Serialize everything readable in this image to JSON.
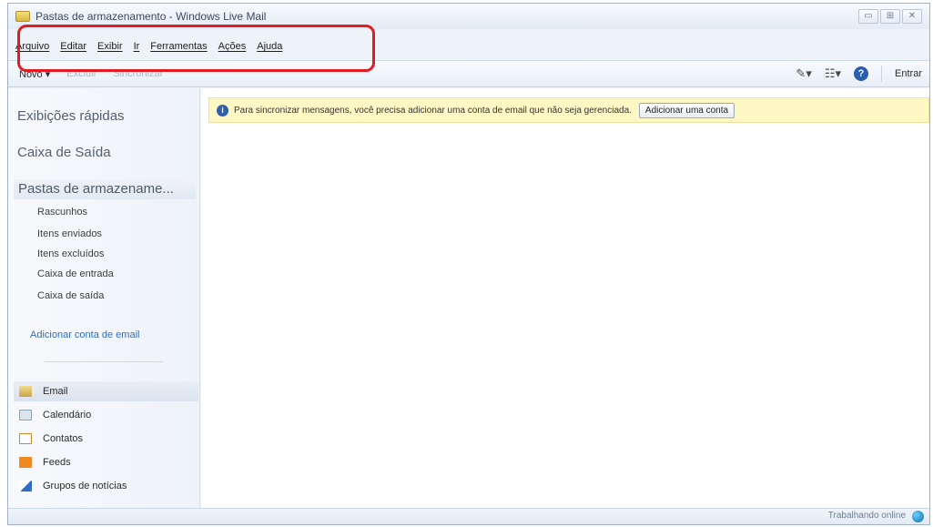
{
  "window": {
    "title": "Pastas de armazenamento - Windows Live Mail",
    "controls": [
      "▭",
      "⊞",
      "✕"
    ]
  },
  "menu": [
    "Arquivo",
    "Editar",
    "Exibir",
    "Ir",
    "Ferramentas",
    "Ações",
    "Ajuda"
  ],
  "toolbar": {
    "new_label": "Novo ▾",
    "faded1": "Excluir",
    "faded2": "Sincronizar",
    "pen_icon": "✎▾",
    "view_icon": "☷▾",
    "help_icon": "?",
    "login_label": "Entrar"
  },
  "sidebar": {
    "quick_views": "Exibições rápidas",
    "outbox_header": "Caixa de Saída",
    "storage_section": "Pastas de armazename...",
    "folders": [
      "Rascunhos",
      "Itens enviados",
      "Itens excluídos",
      "Caixa de entrada",
      "Caixa de saída"
    ],
    "add_account_link": "Adicionar conta de email",
    "nav": [
      "Email",
      "Calendário",
      "Contatos",
      "Feeds",
      "Grupos de notícias"
    ]
  },
  "infobar": {
    "message": "Para sincronizar mensagens, você precisa adicionar uma conta de email que não seja gerenciada.",
    "button": "Adicionar uma conta"
  },
  "status": {
    "text": "Trabalhando online"
  },
  "colors": {
    "highlight": "#e11d23",
    "link": "#2f6cc3",
    "infobar_bg": "#fff8c4"
  }
}
